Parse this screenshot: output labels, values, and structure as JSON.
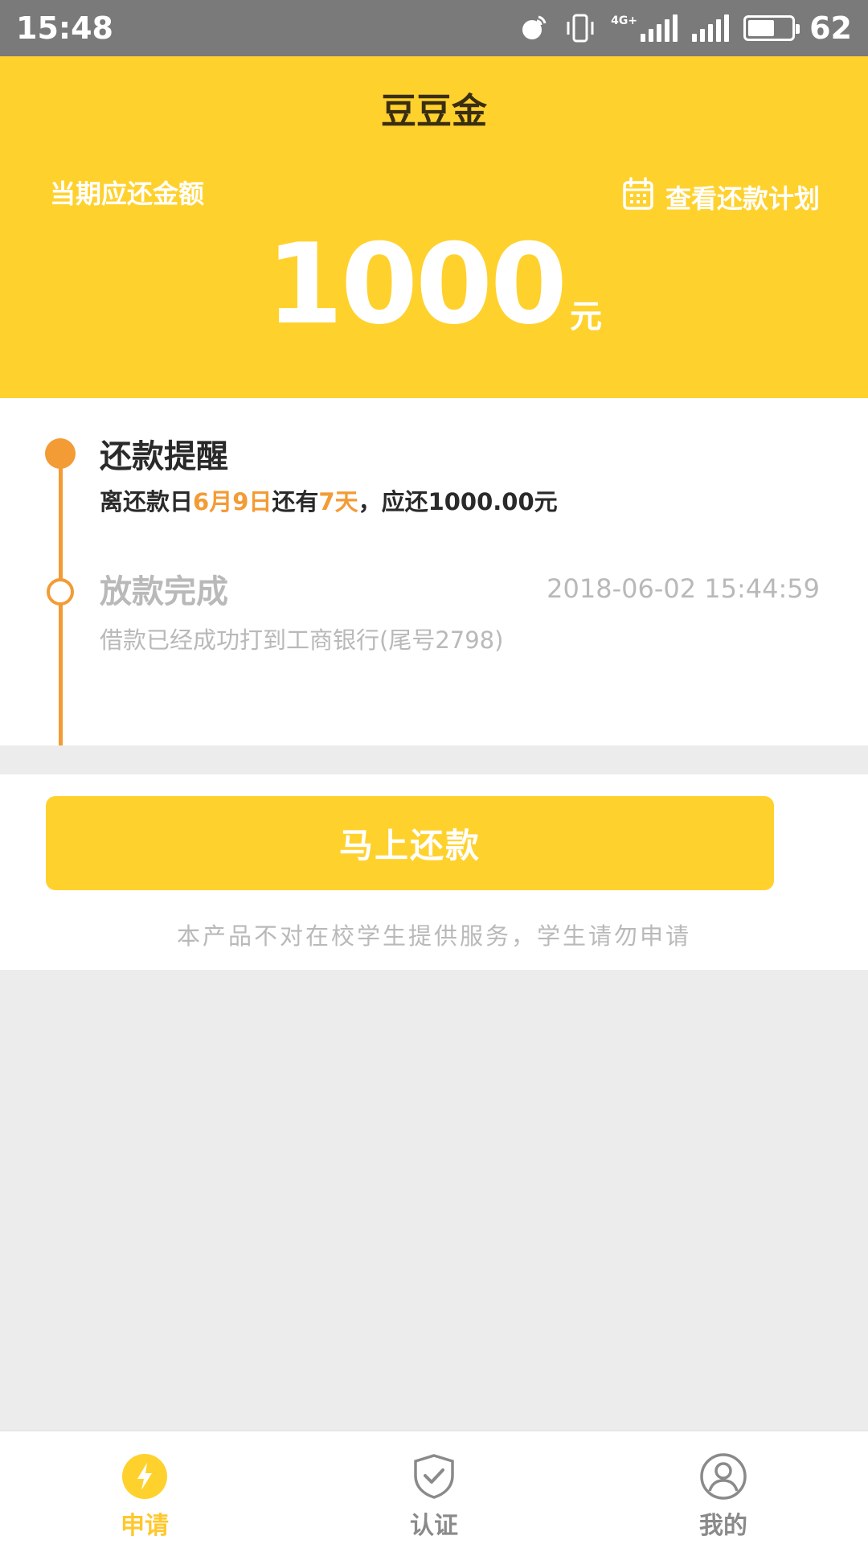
{
  "status_bar": {
    "time": "15:48",
    "network": "4G+",
    "battery": "62",
    "battery_level_percent": 62,
    "icons": [
      "hotspot-icon",
      "vibrate-icon",
      "signal-4g-icon",
      "signal-icon",
      "battery-icon"
    ]
  },
  "header": {
    "title": "豆豆金",
    "due_label": "当期应还金额",
    "plan_link": "查看还款计划",
    "amount": "1000",
    "amount_unit": "元"
  },
  "timeline": {
    "item1": {
      "title": "还款提醒",
      "desc_prefix": "离还款日",
      "due_date": "6月9日",
      "desc_mid": "还有",
      "days_left": "7天",
      "desc_suffix": "，应还1000.00元"
    },
    "item2": {
      "title": "放款完成",
      "timestamp": "2018-06-02 15:44:59",
      "desc": "借款已经成功打到工商银行(尾号2798)"
    }
  },
  "action": {
    "repay_button": "马上还款",
    "notice": "本产品不对在校学生提供服务，学生请勿申请"
  },
  "bottom_nav": {
    "items": [
      {
        "label": "申请",
        "icon": "lightning-icon",
        "active": true
      },
      {
        "label": "认证",
        "icon": "shield-check-icon",
        "active": false
      },
      {
        "label": "我的",
        "icon": "user-icon",
        "active": false
      }
    ]
  },
  "colors": {
    "brand_yellow": "#ffd12d",
    "accent_orange": "#f39b35",
    "muted_gray": "#b9b9b9",
    "status_bar_gray": "#7a7a7a"
  }
}
